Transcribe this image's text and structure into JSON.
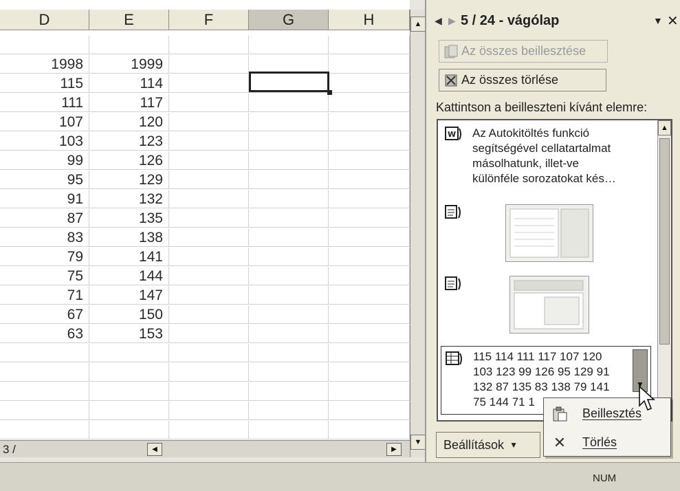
{
  "spreadsheet": {
    "columns": [
      "D",
      "E",
      "F",
      "G",
      "H"
    ],
    "selected_column": "G",
    "rows": [
      [
        "",
        ""
      ],
      [
        "1998",
        "1999"
      ],
      [
        "115",
        "114"
      ],
      [
        "111",
        "117"
      ],
      [
        "107",
        "120"
      ],
      [
        "103",
        "123"
      ],
      [
        "99",
        "126"
      ],
      [
        "95",
        "129"
      ],
      [
        "91",
        "132"
      ],
      [
        "87",
        "135"
      ],
      [
        "83",
        "138"
      ],
      [
        "79",
        "141"
      ],
      [
        "75",
        "144"
      ],
      [
        "71",
        "147"
      ],
      [
        "67",
        "150"
      ],
      [
        "63",
        "153"
      ]
    ],
    "sheet_tab": "3 /"
  },
  "task_pane": {
    "counter": "5 / 24 - vágólap",
    "paste_all": "Az összes beillesztése",
    "clear_all": "Az összes törlése",
    "instruction": "Kattintson a beilleszteni kívánt elemre:",
    "clip_1": [
      "Az Autokitöltés funkció",
      "segítségével cellatartalmat",
      "másolhatunk, illet-ve",
      "különféle sorozatokat kés…"
    ],
    "clip_4": [
      "115 114 111 117 107 120",
      "103 123 99 126 95 129 91",
      "132 87 135 83 138 79 141",
      "75 144 71 1"
    ],
    "options": "Beállítások"
  },
  "context_menu": {
    "paste": "Beillesztés",
    "delete": "Törlés"
  },
  "status": {
    "num": "NUM"
  }
}
